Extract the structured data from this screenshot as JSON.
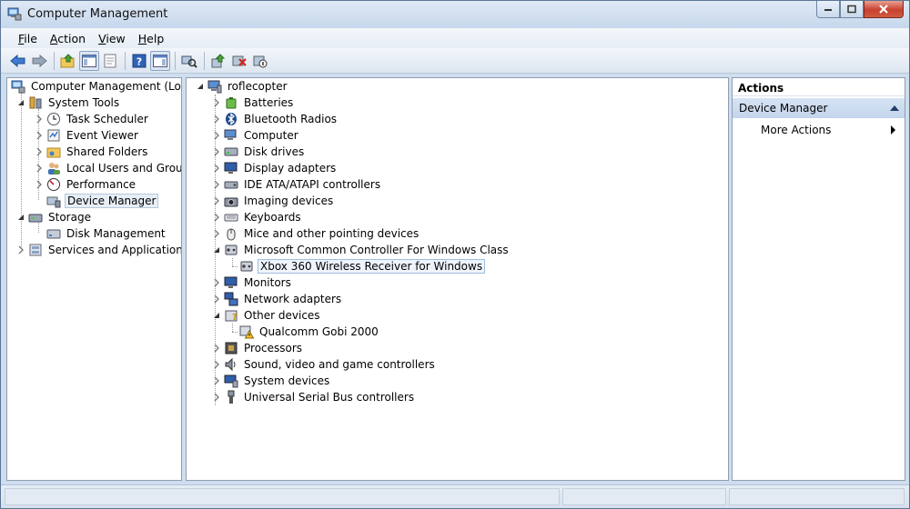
{
  "window": {
    "title": "Computer Management",
    "icon": "computer-management-icon",
    "caption_buttons": [
      "minimize",
      "maximize",
      "close"
    ]
  },
  "menu": [
    {
      "label_underlined": "F",
      "label_rest": "ile"
    },
    {
      "label_underlined": "A",
      "label_rest": "ction"
    },
    {
      "label_underlined": "V",
      "label_rest": "iew"
    },
    {
      "label_underlined": "H",
      "label_rest": "elp"
    }
  ],
  "toolbar": {
    "buttons": [
      "back-arrow-icon",
      "forward-arrow-icon",
      "up-folder-icon",
      "show-hide-tree-icon",
      "properties-icon",
      "help-icon",
      "show-hide-action-pane-icon",
      "scan-hardware-icon",
      "update-driver-icon",
      "uninstall-device-icon",
      "disable-device-icon"
    ]
  },
  "left_tree": {
    "root": "Computer Management (Local",
    "system_tools": "System Tools",
    "task_scheduler": "Task Scheduler",
    "event_viewer": "Event Viewer",
    "shared_folders": "Shared Folders",
    "local_users": "Local Users and Groups",
    "performance": "Performance",
    "device_manager": "Device Manager",
    "storage": "Storage",
    "disk_management": "Disk Management",
    "services_apps": "Services and Applications"
  },
  "device_tree": {
    "computer_name": "roflecopter",
    "categories": {
      "batteries": "Batteries",
      "bluetooth": "Bluetooth Radios",
      "computer": "Computer",
      "disk_drives": "Disk drives",
      "display": "Display adapters",
      "ide": "IDE ATA/ATAPI controllers",
      "imaging": "Imaging devices",
      "keyboards": "Keyboards",
      "mice": "Mice and other pointing devices",
      "ms_controller": "Microsoft Common Controller For Windows Class",
      "xbox_receiver": "Xbox 360 Wireless Receiver for Windows",
      "monitors": "Monitors",
      "network": "Network adapters",
      "other": "Other devices",
      "qualcomm": "Qualcomm Gobi 2000",
      "processors": "Processors",
      "sound": "Sound, video and game controllers",
      "system": "System devices",
      "usb": "Universal Serial Bus controllers"
    }
  },
  "actions": {
    "header": "Actions",
    "section": "Device Manager",
    "more_actions": "More Actions"
  },
  "colors": {
    "window_frame": "#cfdeee",
    "actions_section": "#c8d9ee",
    "selection": "#e8eef6",
    "close_button": "#c8412f"
  }
}
